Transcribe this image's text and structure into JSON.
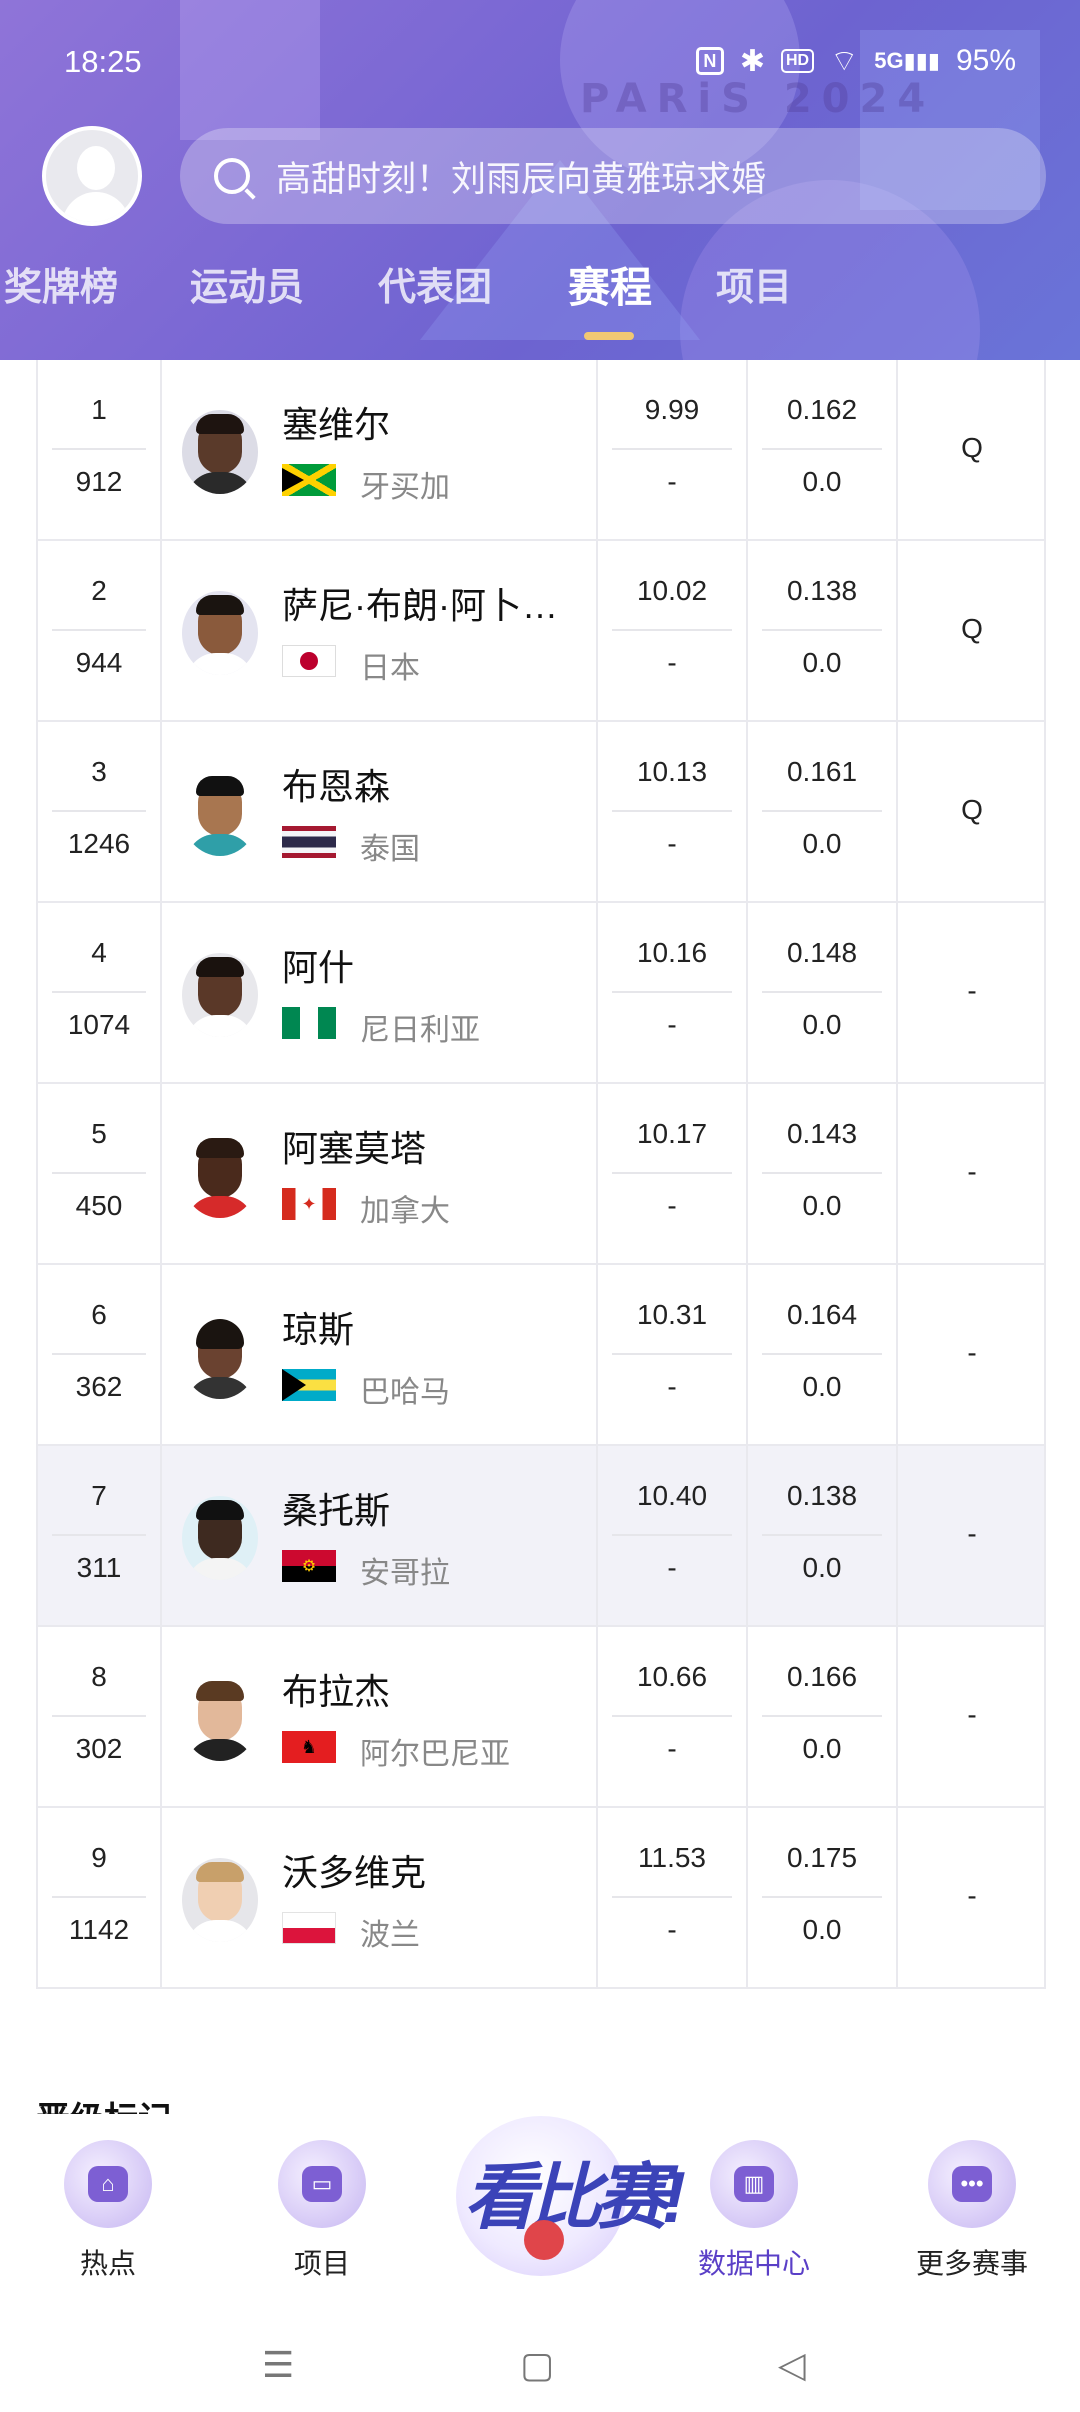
{
  "status": {
    "time": "18:25",
    "battery": "95%",
    "network": "5G"
  },
  "header": {
    "watermark": "PARiS 2024",
    "search_placeholder": "高甜时刻！刘雨辰向黄雅琼求婚",
    "tabs": [
      {
        "label": "奖牌榜"
      },
      {
        "label": "运动员"
      },
      {
        "label": "代表团"
      },
      {
        "label": "赛程"
      },
      {
        "label": "项目"
      }
    ],
    "active_tab": "赛程"
  },
  "rows": [
    {
      "rank": "1",
      "bib": "912",
      "name": "塞维尔",
      "country": "牙买加",
      "flag": "jamaica",
      "time": "9.99",
      "time_sub": "-",
      "reaction": "0.162",
      "reaction_sub": "0.0",
      "q": "Q"
    },
    {
      "rank": "2",
      "bib": "944",
      "name": "萨尼·布朗·阿卜…",
      "country": "日本",
      "flag": "japan",
      "time": "10.02",
      "time_sub": "-",
      "reaction": "0.138",
      "reaction_sub": "0.0",
      "q": "Q"
    },
    {
      "rank": "3",
      "bib": "1246",
      "name": "布恩森",
      "country": "泰国",
      "flag": "thailand",
      "time": "10.13",
      "time_sub": "-",
      "reaction": "0.161",
      "reaction_sub": "0.0",
      "q": "Q"
    },
    {
      "rank": "4",
      "bib": "1074",
      "name": "阿什",
      "country": "尼日利亚",
      "flag": "nigeria",
      "time": "10.16",
      "time_sub": "-",
      "reaction": "0.148",
      "reaction_sub": "0.0",
      "q": "-"
    },
    {
      "rank": "5",
      "bib": "450",
      "name": "阿塞莫塔",
      "country": "加拿大",
      "flag": "canada",
      "time": "10.17",
      "time_sub": "-",
      "reaction": "0.143",
      "reaction_sub": "0.0",
      "q": "-"
    },
    {
      "rank": "6",
      "bib": "362",
      "name": "琼斯",
      "country": "巴哈马",
      "flag": "bahamas",
      "time": "10.31",
      "time_sub": "-",
      "reaction": "0.164",
      "reaction_sub": "0.0",
      "q": "-"
    },
    {
      "rank": "7",
      "bib": "311",
      "name": "桑托斯",
      "country": "安哥拉",
      "flag": "angola",
      "time": "10.40",
      "time_sub": "-",
      "reaction": "0.138",
      "reaction_sub": "0.0",
      "q": "-"
    },
    {
      "rank": "8",
      "bib": "302",
      "name": "布拉杰",
      "country": "阿尔巴尼亚",
      "flag": "albania",
      "time": "10.66",
      "time_sub": "-",
      "reaction": "0.166",
      "reaction_sub": "0.0",
      "q": "-"
    },
    {
      "rank": "9",
      "bib": "1142",
      "name": "沃多维克",
      "country": "波兰",
      "flag": "poland",
      "time": "11.53",
      "time_sub": "-",
      "reaction": "0.175",
      "reaction_sub": "0.0",
      "q": "-"
    }
  ],
  "section_peek": "晋级标记",
  "bottom_nav": {
    "items": [
      {
        "label": "热点",
        "icon": "home-icon"
      },
      {
        "label": "项目",
        "icon": "list-icon"
      },
      {
        "label": "数据中心",
        "icon": "data-chart-icon"
      },
      {
        "label": "更多赛事",
        "icon": "more-dots-icon"
      }
    ],
    "center_button_text": "看比赛!",
    "active": "数据中心"
  },
  "colors": {
    "header_purple": "#7c69d4",
    "tab_indicator": "#f1c873",
    "nav_active": "#5a3fc7",
    "highlight_row": "#f2f2f8"
  }
}
